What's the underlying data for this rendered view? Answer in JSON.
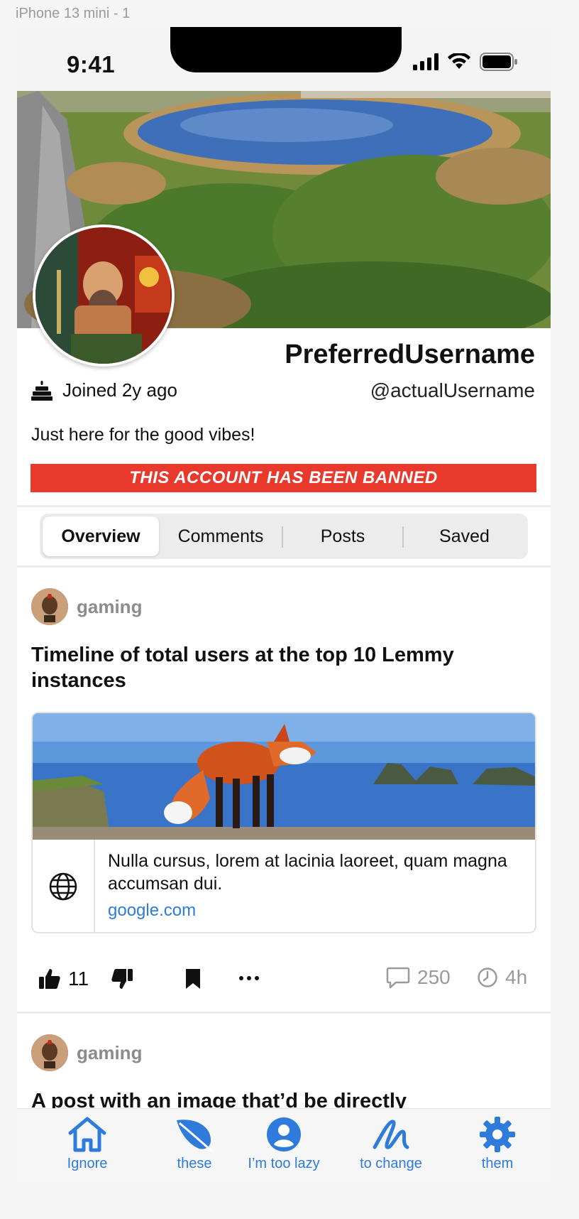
{
  "frame_label": "iPhone 13 mini - 1",
  "status_bar": {
    "time": "9:41"
  },
  "profile": {
    "display_name": "PreferredUsername",
    "handle": "@actualUsername",
    "joined": "Joined 2y ago",
    "bio": "Just here for the good vibes!",
    "banned_notice": "THIS ACCOUNT HAS BEEN BANNED"
  },
  "tabs": [
    {
      "label": "Overview",
      "active": true
    },
    {
      "label": "Comments",
      "active": false
    },
    {
      "label": "Posts",
      "active": false
    },
    {
      "label": "Saved",
      "active": false
    }
  ],
  "posts": [
    {
      "community": "gaming",
      "title": "Timeline of total users at the top 10 Lemmy instances",
      "link": {
        "description": "Nulla cursus, lorem at lacinia laoreet, quam magna accumsan dui.",
        "url": "google.com"
      },
      "upvotes": "11",
      "comments": "250",
      "age": "4h"
    },
    {
      "community": "gaming",
      "title": "A post with an image that’d be directly"
    }
  ],
  "tab_bar": [
    {
      "label": "Ignore",
      "icon": "home-icon"
    },
    {
      "label": "these",
      "icon": "leaf-icon"
    },
    {
      "label": "I’m too lazy",
      "icon": "person-icon"
    },
    {
      "label": "to change",
      "icon": "scribble-icon"
    },
    {
      "label": "them",
      "icon": "gear-icon"
    }
  ],
  "colors": {
    "accent": "#2e7bdc",
    "banned": "#e8392c",
    "muted": "#9a9a9a"
  }
}
